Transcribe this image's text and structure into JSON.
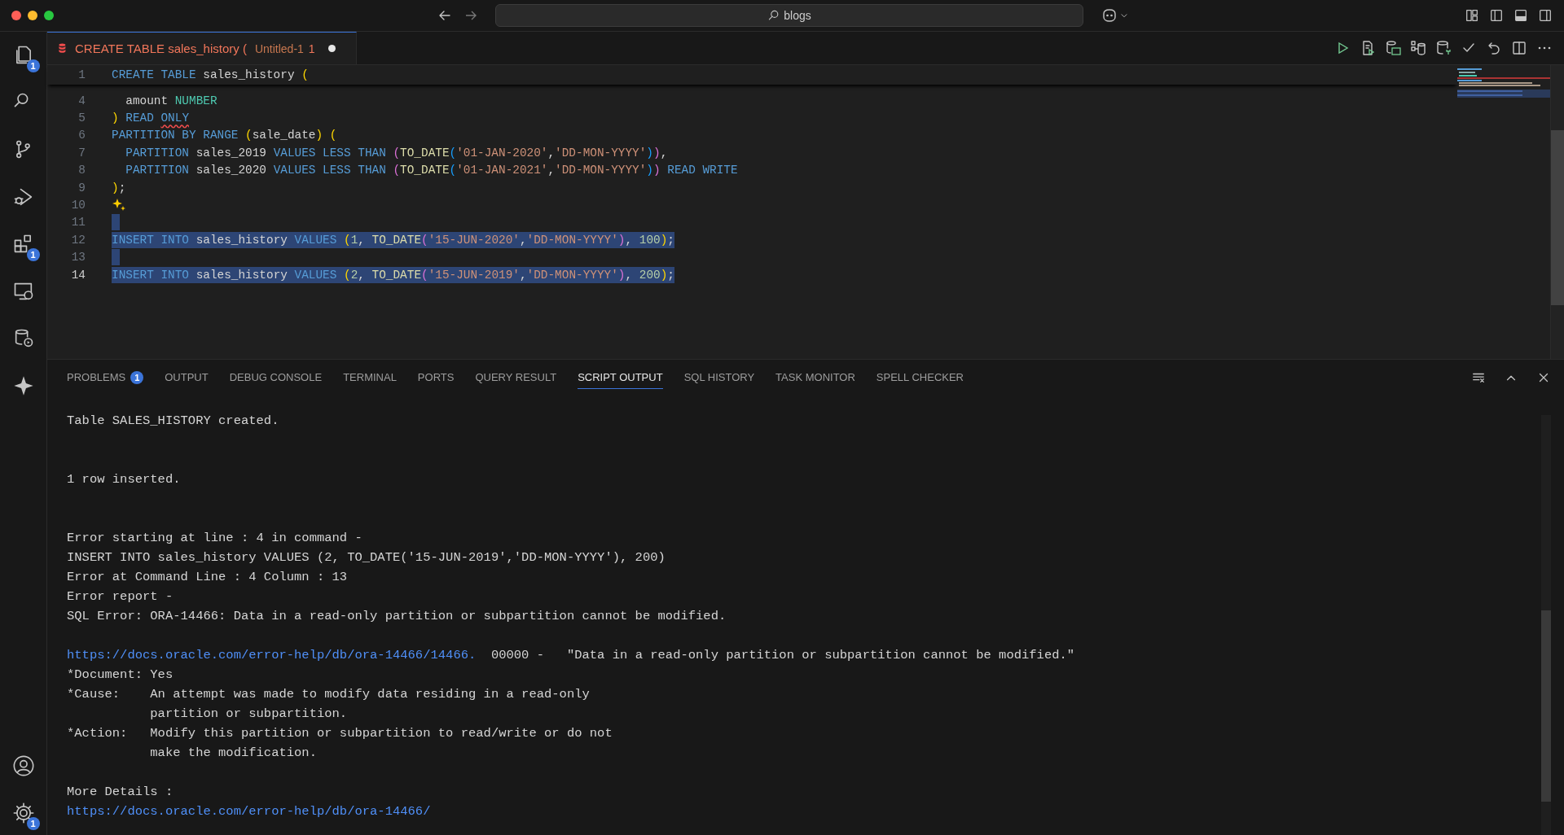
{
  "titlebar": {
    "search": {
      "value": "blogs"
    }
  },
  "activity_bar": {
    "items": [
      {
        "kind": "files",
        "badge": "1"
      },
      {
        "kind": "search"
      },
      {
        "kind": "branch"
      },
      {
        "kind": "debug"
      },
      {
        "kind": "extensions",
        "badge": "1"
      },
      {
        "kind": "remote"
      },
      {
        "kind": "database"
      },
      {
        "kind": "sparkle"
      }
    ],
    "bottom": [
      {
        "kind": "account"
      },
      {
        "kind": "gear",
        "badge": "1"
      }
    ]
  },
  "editor_tab": {
    "title": "CREATE TABLE sales_history (",
    "file": "Untitled-1",
    "problems": "1",
    "modified": true,
    "selected": true
  },
  "code": [
    {
      "number": "1",
      "sticky": true,
      "tokens": [
        {
          "text": "CREATE TABLE ",
          "kind": "kw"
        },
        {
          "text": "sales_history ",
          "kind": "id"
        },
        {
          "text": "(",
          "kind": "p1"
        }
      ]
    },
    {
      "number": "4",
      "tokens": [
        {
          "text": "  amount ",
          "kind": "id"
        },
        {
          "text": "NUMBER",
          "kind": "ty"
        }
      ]
    },
    {
      "number": "5",
      "tokens": [
        {
          "text": ")",
          "kind": "p1"
        },
        {
          "text": " READ ",
          "kind": "kw"
        },
        {
          "text": "ONLY",
          "kind": "kw",
          "squiggle": true
        }
      ]
    },
    {
      "number": "6",
      "tokens": [
        {
          "text": "PARTITION BY RANGE ",
          "kind": "kw"
        },
        {
          "text": "(",
          "kind": "p1"
        },
        {
          "text": "sale_date",
          "kind": "id"
        },
        {
          "text": ")",
          "kind": "p1"
        },
        {
          "text": " (",
          "kind": "p1"
        }
      ]
    },
    {
      "number": "7",
      "tokens": [
        {
          "text": "  PARTITION ",
          "kind": "kw"
        },
        {
          "text": "sales_2019 ",
          "kind": "id"
        },
        {
          "text": "VALUES LESS THAN ",
          "kind": "kw"
        },
        {
          "text": "(",
          "kind": "p2"
        },
        {
          "text": "TO_DATE",
          "kind": "fn"
        },
        {
          "text": "(",
          "kind": "p3"
        },
        {
          "text": "'01-JAN-2020'",
          "kind": "st"
        },
        {
          "text": ",",
          "kind": "pu"
        },
        {
          "text": "'DD-MON-YYYY'",
          "kind": "st"
        },
        {
          "text": ")",
          "kind": "p3"
        },
        {
          "text": ")",
          "kind": "p2"
        },
        {
          "text": ",",
          "kind": "pu"
        }
      ]
    },
    {
      "number": "8",
      "tokens": [
        {
          "text": "  PARTITION ",
          "kind": "kw"
        },
        {
          "text": "sales_2020 ",
          "kind": "id"
        },
        {
          "text": "VALUES LESS THAN ",
          "kind": "kw"
        },
        {
          "text": "(",
          "kind": "p2"
        },
        {
          "text": "TO_DATE",
          "kind": "fn"
        },
        {
          "text": "(",
          "kind": "p3"
        },
        {
          "text": "'01-JAN-2021'",
          "kind": "st"
        },
        {
          "text": ",",
          "kind": "pu"
        },
        {
          "text": "'DD-MON-YYYY'",
          "kind": "st"
        },
        {
          "text": ")",
          "kind": "p3"
        },
        {
          "text": ")",
          "kind": "p2"
        },
        {
          "text": " READ WRITE",
          "kind": "kw"
        }
      ]
    },
    {
      "number": "9",
      "tokens": [
        {
          "text": ")",
          "kind": "p1"
        },
        {
          "text": ";",
          "kind": "pu"
        }
      ]
    },
    {
      "number": "10",
      "hint": true
    },
    {
      "number": "11",
      "selected": true
    },
    {
      "number": "12",
      "selected": true,
      "tokens": [
        {
          "text": "INSERT INTO ",
          "kind": "kw"
        },
        {
          "text": "sales_history ",
          "kind": "id"
        },
        {
          "text": "VALUES ",
          "kind": "kw"
        },
        {
          "text": "(",
          "kind": "p1"
        },
        {
          "text": "1",
          "kind": "nu"
        },
        {
          "text": ", ",
          "kind": "pu"
        },
        {
          "text": "TO_DATE",
          "kind": "fn"
        },
        {
          "text": "(",
          "kind": "p2"
        },
        {
          "text": "'15-JUN-2020'",
          "kind": "st"
        },
        {
          "text": ",",
          "kind": "pu"
        },
        {
          "text": "'DD-MON-YYYY'",
          "kind": "st"
        },
        {
          "text": ")",
          "kind": "p2"
        },
        {
          "text": ", ",
          "kind": "pu"
        },
        {
          "text": "100",
          "kind": "nu"
        },
        {
          "text": ")",
          "kind": "p1"
        },
        {
          "text": ";",
          "kind": "pu"
        }
      ]
    },
    {
      "number": "13",
      "selected": true
    },
    {
      "number": "14",
      "selected": true,
      "active": true,
      "tokens": [
        {
          "text": "INSERT INTO ",
          "kind": "kw"
        },
        {
          "text": "sales_history ",
          "kind": "id"
        },
        {
          "text": "VALUES ",
          "kind": "kw"
        },
        {
          "text": "(",
          "kind": "p1"
        },
        {
          "text": "2",
          "kind": "nu"
        },
        {
          "text": ", ",
          "kind": "pu"
        },
        {
          "text": "TO_DATE",
          "kind": "fn"
        },
        {
          "text": "(",
          "kind": "p2"
        },
        {
          "text": "'15-JUN-2019'",
          "kind": "st"
        },
        {
          "text": ",",
          "kind": "pu"
        },
        {
          "text": "'DD-MON-YYYY'",
          "kind": "st"
        },
        {
          "text": ")",
          "kind": "p2"
        },
        {
          "text": ", ",
          "kind": "pu"
        },
        {
          "text": "200",
          "kind": "nu"
        },
        {
          "text": ")",
          "kind": "p1"
        },
        {
          "text": ";",
          "kind": "pu"
        }
      ]
    }
  ],
  "panel": {
    "tabs": [
      {
        "label": "PROBLEMS",
        "badge": "1",
        "selected": false
      },
      {
        "label": "OUTPUT",
        "selected": false
      },
      {
        "label": "DEBUG CONSOLE",
        "selected": false
      },
      {
        "label": "TERMINAL",
        "selected": false
      },
      {
        "label": "PORTS",
        "selected": false
      },
      {
        "label": "QUERY RESULT",
        "selected": false
      },
      {
        "label": "SCRIPT OUTPUT",
        "selected": true
      },
      {
        "label": "SQL HISTORY",
        "selected": false
      },
      {
        "label": "TASK MONITOR",
        "selected": false
      },
      {
        "label": "SPELL CHECKER",
        "selected": false
      }
    ],
    "output": [
      {
        "kind": "text",
        "segments": [
          {
            "text": "Table SALES_HISTORY created.",
            "kind": "plain"
          }
        ]
      },
      {
        "kind": "blank"
      },
      {
        "kind": "blank"
      },
      {
        "kind": "text",
        "segments": [
          {
            "text": "1 row inserted.",
            "kind": "plain"
          }
        ]
      },
      {
        "kind": "blank"
      },
      {
        "kind": "blank"
      },
      {
        "kind": "text",
        "segments": [
          {
            "text": "Error starting at line : 4 in command -",
            "kind": "plain"
          }
        ]
      },
      {
        "kind": "text",
        "segments": [
          {
            "text": "INSERT INTO sales_history VALUES (2, TO_DATE('15-JUN-2019','DD-MON-YYYY'), 200)",
            "kind": "plain"
          }
        ]
      },
      {
        "kind": "text",
        "segments": [
          {
            "text": "Error at Command Line : 4 Column : 13",
            "kind": "plain"
          }
        ]
      },
      {
        "kind": "text",
        "segments": [
          {
            "text": "Error report -",
            "kind": "plain"
          }
        ]
      },
      {
        "kind": "text",
        "segments": [
          {
            "text": "SQL Error: ORA-14466: Data in a read-only partition or subpartition cannot be modified.",
            "kind": "plain"
          }
        ]
      },
      {
        "kind": "blank"
      },
      {
        "kind": "text",
        "segments": [
          {
            "text": "https://docs.oracle.com/error-help/db/ora-14466/14466.",
            "kind": "link"
          },
          {
            "text": "  00000 -   \"Data in a read-only partition or subpartition cannot be modified.\"",
            "kind": "plain"
          }
        ]
      },
      {
        "kind": "text",
        "segments": [
          {
            "text": "*Document: Yes",
            "kind": "plain"
          }
        ]
      },
      {
        "kind": "text",
        "segments": [
          {
            "text": "*Cause:    An attempt was made to modify data residing in a read-only",
            "kind": "plain"
          }
        ]
      },
      {
        "kind": "text",
        "segments": [
          {
            "text": "           partition or subpartition.",
            "kind": "plain"
          }
        ]
      },
      {
        "kind": "text",
        "segments": [
          {
            "text": "*Action:   Modify this partition or subpartition to read/write or do not",
            "kind": "plain"
          }
        ]
      },
      {
        "kind": "text",
        "segments": [
          {
            "text": "           make the modification.",
            "kind": "plain"
          }
        ]
      },
      {
        "kind": "blank"
      },
      {
        "kind": "text",
        "segments": [
          {
            "text": "More Details :",
            "kind": "plain"
          }
        ]
      },
      {
        "kind": "text",
        "segments": [
          {
            "text": "https://docs.oracle.com/error-help/db/ora-14466/",
            "kind": "link"
          }
        ]
      }
    ]
  }
}
